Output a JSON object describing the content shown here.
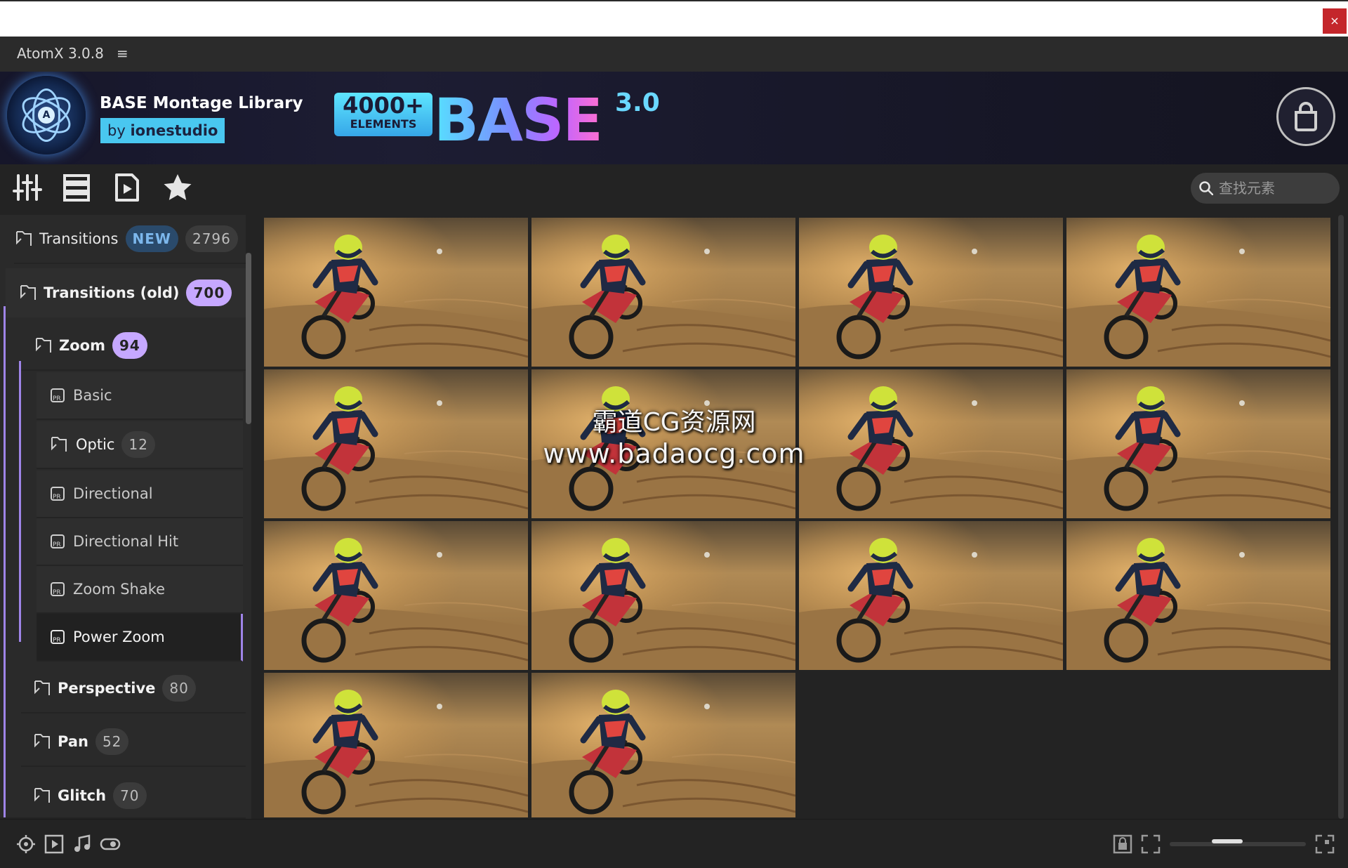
{
  "window": {
    "close_label": "×"
  },
  "app": {
    "title": "AtomX 3.0.8",
    "menu_icon": "≡"
  },
  "banner": {
    "library_title": "BASE Montage Library",
    "by_prefix": "by ",
    "by_author": "ionestudio",
    "logo_letter": "A",
    "base_count": "4000+",
    "base_elements_label": "ELEMENTS",
    "base_word": "BASE",
    "base_version": "3.0"
  },
  "search": {
    "placeholder": "查找元素"
  },
  "sidebar": {
    "items": [
      {
        "label": "Transitions",
        "badge_new": "NEW",
        "count": "2796"
      },
      {
        "label": "Transitions (old)",
        "count": "700"
      },
      {
        "label": "Zoom",
        "count": "94"
      },
      {
        "label": "Basic"
      },
      {
        "label": "Optic",
        "count": "12"
      },
      {
        "label": "Directional"
      },
      {
        "label": "Directional Hit"
      },
      {
        "label": "Zoom Shake"
      },
      {
        "label": "Power Zoom"
      },
      {
        "label": "Perspective",
        "count": "80"
      },
      {
        "label": "Pan",
        "count": "52"
      },
      {
        "label": "Glitch",
        "count": "70"
      }
    ]
  },
  "watermark": {
    "line1": "霸道CG资源网",
    "line2": "www.badaocg.com"
  },
  "colors": {
    "accent": "#9f84e8",
    "badge_purple": "#c6a8ff",
    "by_bg": "#49c7f0",
    "close": "#c4262b"
  },
  "zoom": {
    "level": 0.4
  }
}
